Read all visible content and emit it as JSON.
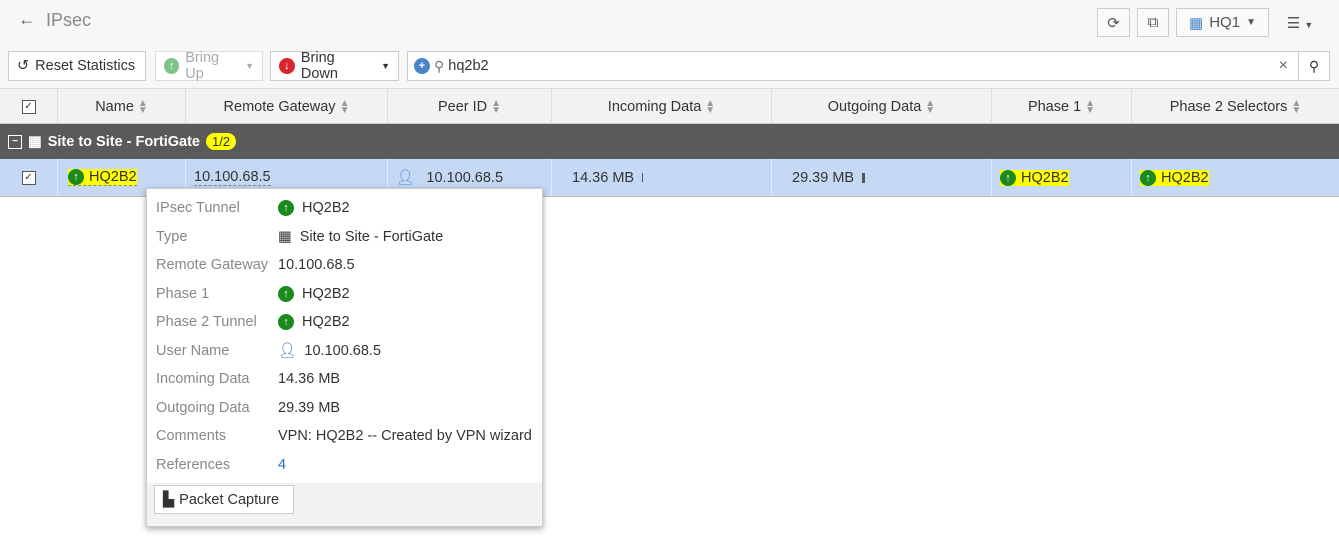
{
  "header": {
    "title": "IPsec",
    "device": "HQ1"
  },
  "toolbar": {
    "reset": "Reset Statistics",
    "bring_up": "Bring Up",
    "bring_down": "Bring Down",
    "search_value": "hq2b2"
  },
  "columns": [
    "Name",
    "Remote Gateway",
    "Peer ID",
    "Incoming Data",
    "Outgoing Data",
    "Phase 1",
    "Phase 2 Selectors"
  ],
  "group": {
    "label": "Site to Site - FortiGate",
    "count": "1/2"
  },
  "row": {
    "name": "HQ2B2",
    "remote_gateway": "10.100.68.5",
    "peer_id": "10.100.68.5",
    "incoming": "14.36 MB",
    "outgoing": "29.39 MB",
    "phase1": "HQ2B2",
    "phase2": "HQ2B2"
  },
  "colors": {
    "up": "#1a8a1a",
    "down": "#d9262c",
    "selected": "#c5d9f5",
    "highlight": "#ffff00"
  },
  "tooltip": {
    "rows": [
      {
        "label": "IPsec Tunnel",
        "value": "HQ2B2",
        "icon": "up"
      },
      {
        "label": "Type",
        "value": "Site to Site - FortiGate",
        "icon": "grid"
      },
      {
        "label": "Remote Gateway",
        "value": "10.100.68.5"
      },
      {
        "label": "Phase 1",
        "value": "HQ2B2",
        "icon": "up"
      },
      {
        "label": "Phase 2 Tunnel",
        "value": "HQ2B2",
        "icon": "up"
      },
      {
        "label": "User Name",
        "value": "10.100.68.5",
        "icon": "user"
      },
      {
        "label": "Incoming Data",
        "value": "14.36 MB"
      },
      {
        "label": "Outgoing Data",
        "value": "29.39 MB"
      },
      {
        "label": "Comments",
        "value": "VPN: HQ2B2 -- Created by VPN wizard"
      },
      {
        "label": "References",
        "value": "4",
        "link": true
      }
    ],
    "packet_capture": "Packet Capture"
  }
}
